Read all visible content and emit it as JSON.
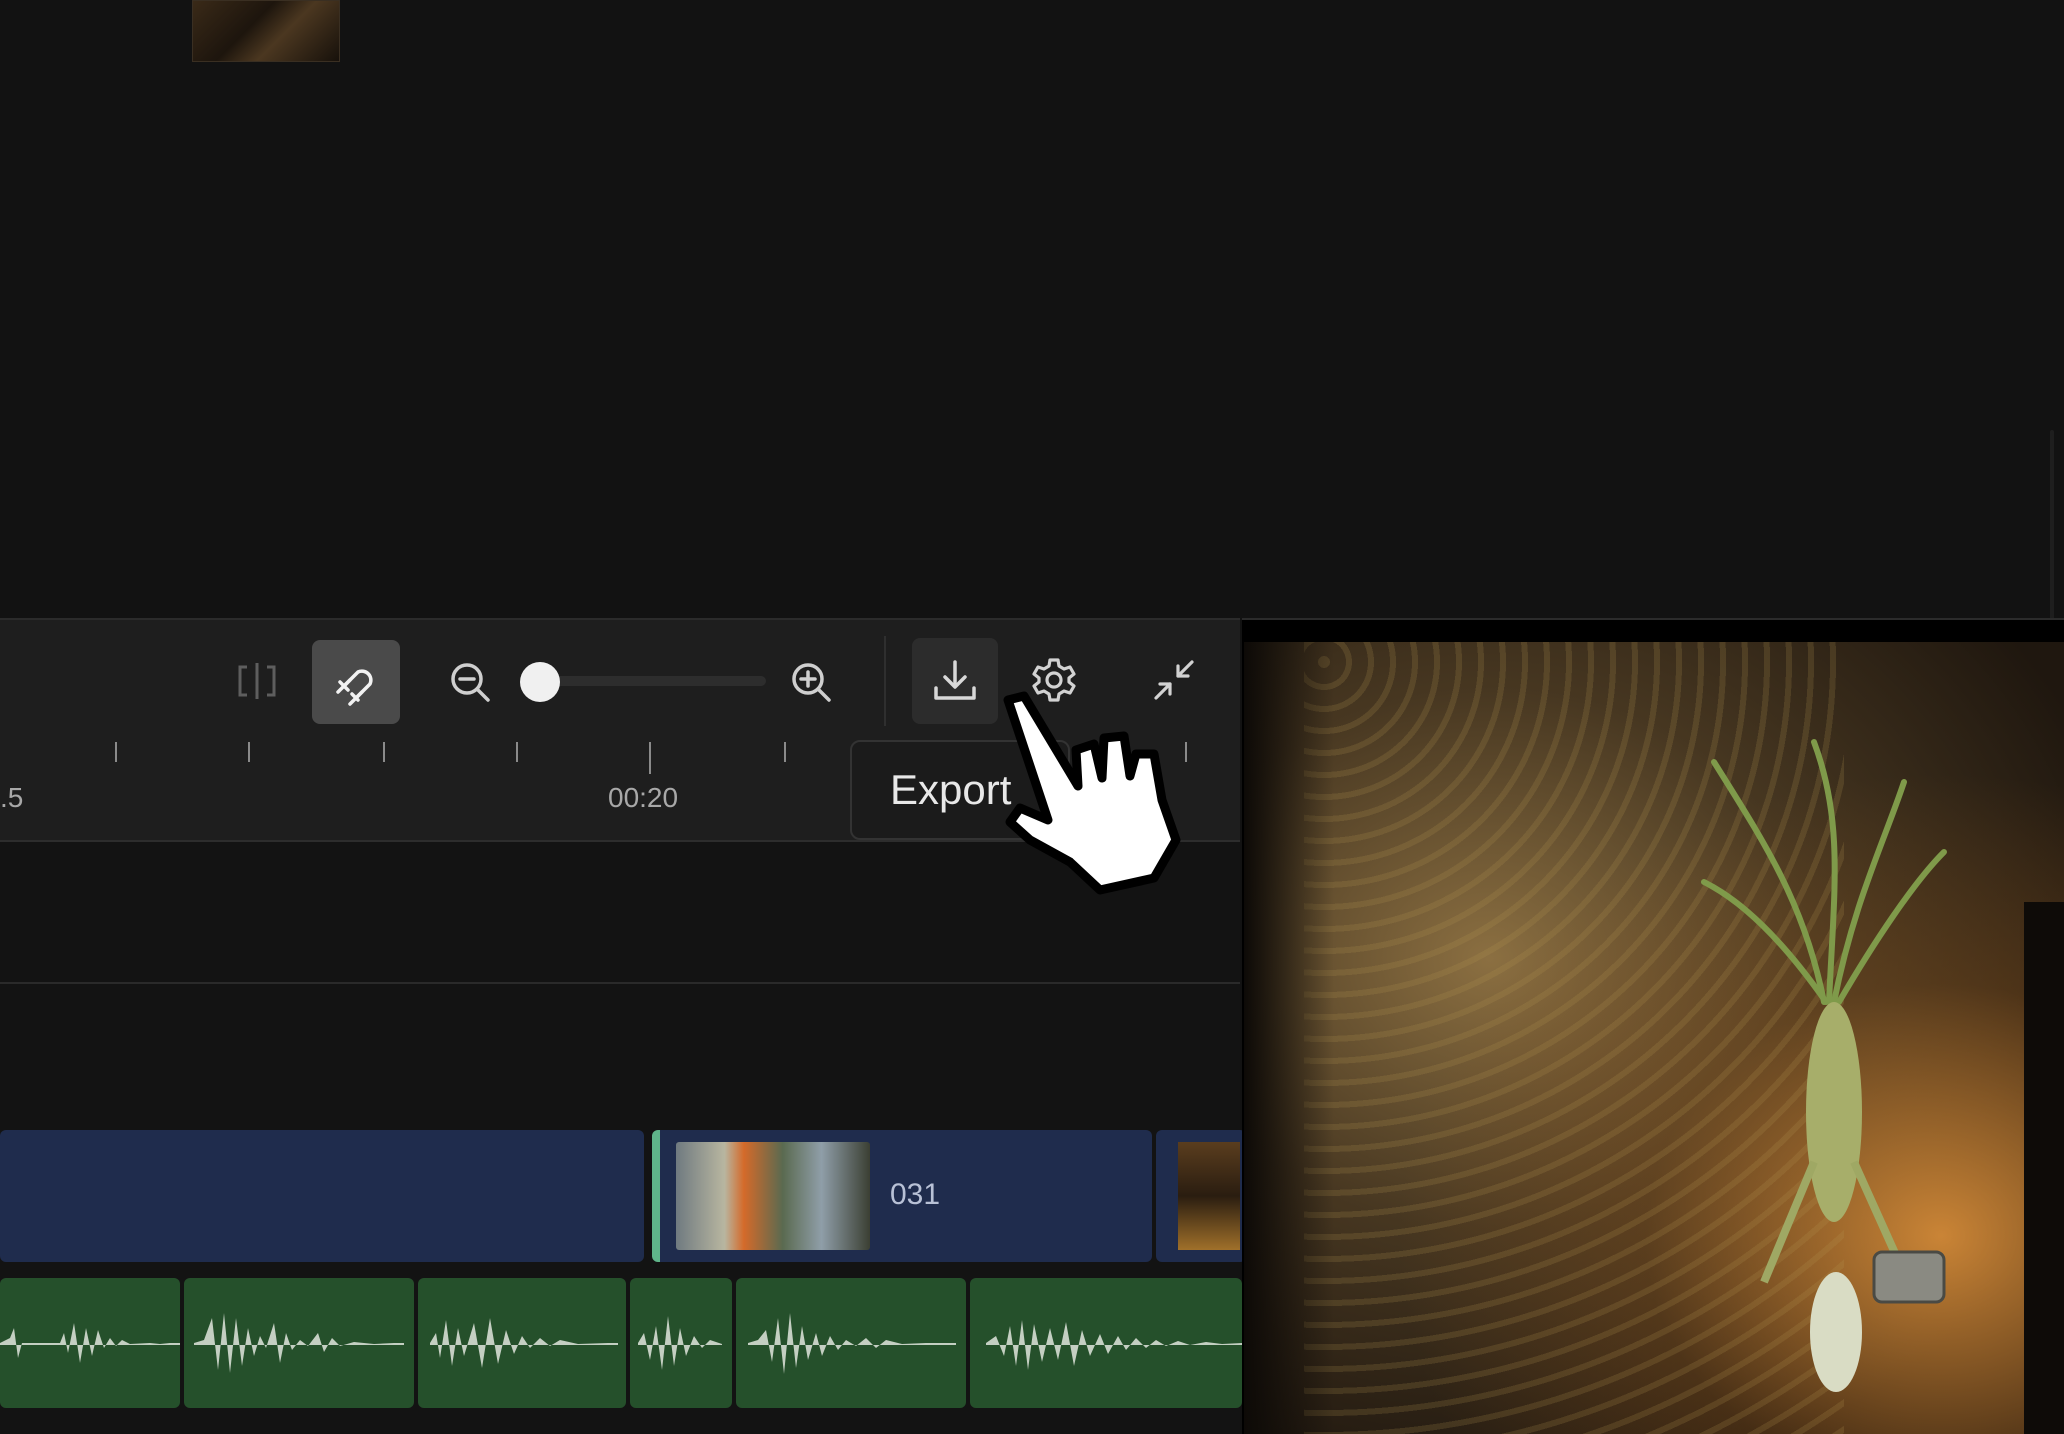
{
  "toolbar": {
    "split_icon": "split-icon",
    "snap_icon": "magnet-icon",
    "zoom_out_icon": "zoom-out-icon",
    "zoom_in_icon": "zoom-in-icon",
    "zoom_level_fraction": 0.0,
    "export_icon": "download-icon",
    "settings_icon": "gear-icon",
    "collapse_icon": "collapse-icon"
  },
  "ruler": {
    "labels": [
      ".5",
      "00:20"
    ]
  },
  "tooltip": {
    "export_label": "Export"
  },
  "video_track": {
    "clips": [
      {
        "label": ""
      },
      {
        "label": "031"
      },
      {
        "label": ""
      }
    ]
  },
  "colors": {
    "video_clip": "#1f2c4d",
    "audio_clip": "#25502b",
    "waveform": "#c4cfc2",
    "selected_clip_edge": "#5fb58a",
    "toolbar_bg": "#1e1e1e",
    "active_button": "#4a4a4a"
  }
}
